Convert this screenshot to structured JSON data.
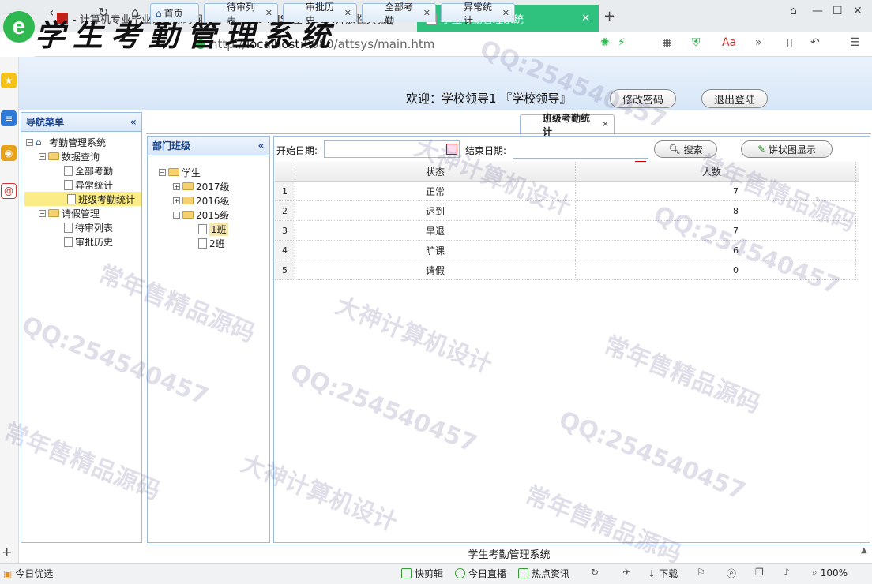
{
  "browser": {
    "tabs": [
      {
        "label": "- 计算机专业毕业设计源码网",
        "icon": "red-flag-icon"
      },
      {
        "label": "946JSP基于SSM开放性实验室管",
        "icon": "red-flag-icon"
      },
      {
        "label": "学生考勤管理系统",
        "icon": "document-icon"
      }
    ],
    "url_protocol": "http://",
    "url_host": "localhost",
    "url_rest": ":8080/attsys/main.htm"
  },
  "header": {
    "title": "学生考勤管理系统",
    "welcome": "欢迎：学校领导1 『学校领导』",
    "change_password": "修改密码",
    "logout": "退出登陆"
  },
  "nav": {
    "title": "导航菜单",
    "root": "考勤管理系统",
    "groups": [
      {
        "label": "数据查询",
        "items": [
          "全部考勤",
          "异常统计",
          "班级考勤统计"
        ]
      },
      {
        "label": "请假管理",
        "items": [
          "待审列表",
          "审批历史"
        ]
      }
    ]
  },
  "dept": {
    "title": "部门班级",
    "root": "学生",
    "years": [
      "2017级",
      "2016级",
      "2015级"
    ],
    "classes": [
      "1班",
      "2班"
    ]
  },
  "tabs": [
    "首页",
    "待审列表",
    "审批历史",
    "全部考勤",
    "异常统计",
    "班级考勤统计"
  ],
  "toolbar": {
    "start_label": "开始日期:",
    "end_label": "结束日期:",
    "start_value": "",
    "end_value": "",
    "search": "搜索",
    "pie": "饼状图显示"
  },
  "grid": {
    "headers": [
      "状态",
      "人数"
    ],
    "rows": [
      {
        "n": "1",
        "status": "正常",
        "count": "7"
      },
      {
        "n": "2",
        "status": "迟到",
        "count": "8"
      },
      {
        "n": "3",
        "status": "早退",
        "count": "7"
      },
      {
        "n": "4",
        "status": "旷课",
        "count": "6"
      },
      {
        "n": "5",
        "status": "请假",
        "count": "0"
      }
    ]
  },
  "footer": "学生考勤管理系统",
  "statusbar": {
    "left": "今日优选",
    "items": [
      "快剪辑",
      "今日直播",
      "热点资讯",
      "下载"
    ],
    "zoom": "100%"
  },
  "watermarks": [
    "QQ:254540457",
    "常年售精品源码",
    "大神计算机设计"
  ]
}
